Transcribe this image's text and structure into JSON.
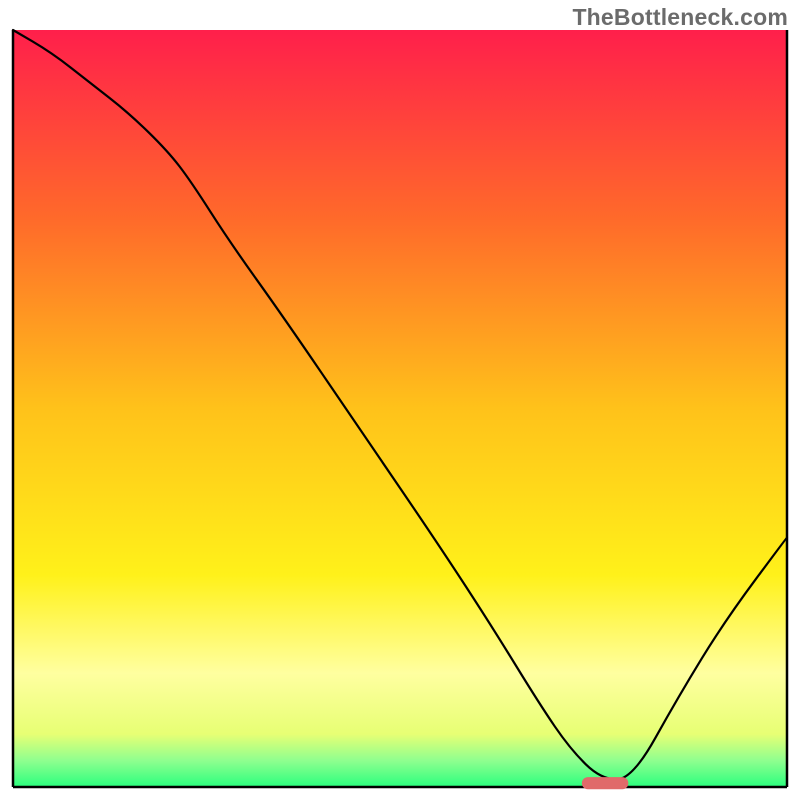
{
  "watermark": "TheBottleneck.com",
  "chart_data": {
    "type": "line",
    "title": "",
    "xlabel": "",
    "ylabel": "",
    "xlim": [
      0,
      100
    ],
    "ylim": [
      0,
      100
    ],
    "grid": false,
    "legend": false,
    "background_gradient_stops": [
      {
        "offset": 0.0,
        "color": "#ff1f4b"
      },
      {
        "offset": 0.25,
        "color": "#ff6a2a"
      },
      {
        "offset": 0.5,
        "color": "#ffc21a"
      },
      {
        "offset": 0.72,
        "color": "#fff11a"
      },
      {
        "offset": 0.85,
        "color": "#ffffa0"
      },
      {
        "offset": 0.93,
        "color": "#e7ff74"
      },
      {
        "offset": 0.965,
        "color": "#8fff8f"
      },
      {
        "offset": 1.0,
        "color": "#2bff7e"
      }
    ],
    "series": [
      {
        "name": "bottleneck-curve",
        "color": "#000000",
        "stroke_width": 2.2,
        "x": [
          0,
          5,
          10,
          15,
          20,
          23,
          28,
          35,
          45,
          55,
          62,
          68,
          72,
          76,
          80,
          86,
          92,
          100
        ],
        "y": [
          100,
          97,
          93,
          89,
          84,
          80,
          72,
          62,
          47,
          32,
          21,
          11,
          5,
          1,
          1,
          12,
          22,
          33
        ]
      }
    ],
    "marker": {
      "name": "optimal-region",
      "color": "#e06a6a",
      "x_start": 73.5,
      "x_end": 79.5,
      "y": 0.5,
      "height": 1.6
    },
    "axes": {
      "x_baseline_y": 0,
      "frame": {
        "left": true,
        "right": true,
        "top": false,
        "bottom": true
      }
    }
  }
}
